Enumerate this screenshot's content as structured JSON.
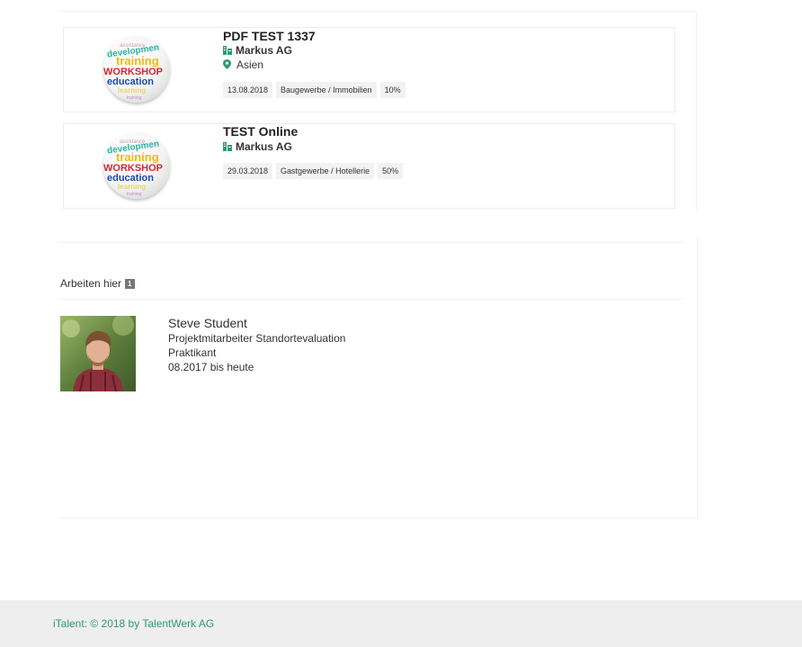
{
  "listings": [
    {
      "title": "PDF TEST 1337",
      "company": "Markus AG",
      "location": "Asien",
      "tags": [
        "13.08.2018",
        "Baugewerbe / Immobilien",
        "10%"
      ],
      "image": "workshop-word-cloud-sphere",
      "company_icon": "building-icon",
      "location_icon": "map-pin-icon"
    },
    {
      "title": "TEST Online",
      "company": "Markus AG",
      "tags": [
        "29.03.2018",
        "Gastgewerbe / Hotellerie",
        "50%"
      ],
      "image": "workshop-word-cloud-sphere",
      "company_icon": "building-icon"
    }
  ],
  "workers": {
    "title": "Arbeiten hier",
    "count": "1",
    "people": [
      {
        "name": "Steve Student",
        "position": "Projektmitarbeiter Standortevaluation",
        "type": "Praktikant",
        "period": "08.2017 bis heute"
      }
    ]
  },
  "footer": {
    "text": "iTalent: © 2018 by TalentWerk AG"
  },
  "colors": {
    "accent": "#2e9a73",
    "badge": "#777777",
    "footer_bg": "#eeeeee"
  }
}
